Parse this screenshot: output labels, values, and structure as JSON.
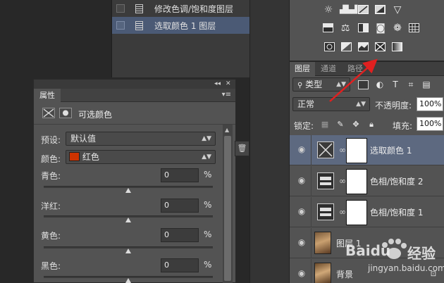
{
  "history": {
    "items": [
      {
        "label": "修改色调/饱和度图层",
        "selected": false
      },
      {
        "label": "选取颜色 1 图层",
        "selected": true
      }
    ]
  },
  "properties": {
    "tab_label": "属性",
    "title": "可选颜色",
    "preset_label": "预设:",
    "preset_value": "默认值",
    "colors_label": "颜色:",
    "colors_value": "红色",
    "colors_swatch": "#cc3300",
    "sliders": [
      {
        "label": "青色:",
        "value": "0",
        "unit": "%",
        "level": 0.5
      },
      {
        "label": "洋红:",
        "value": "0",
        "unit": "%",
        "level": 0.5
      },
      {
        "label": "黄色:",
        "value": "0",
        "unit": "%",
        "level": 0.5
      },
      {
        "label": "黑色:",
        "value": "0",
        "unit": "%",
        "level": 0.5
      }
    ]
  },
  "layers_panel": {
    "tabs": [
      "图层",
      "通道",
      "路径"
    ],
    "active_tab": "图层",
    "filter_kind": "类型",
    "blend_mode": "正常",
    "opacity_label": "不透明度:",
    "opacity_value": "100%",
    "lock_label": "锁定:",
    "fill_label": "填充:",
    "fill_value": "100%",
    "layers": [
      {
        "name": "选取颜色 1",
        "kind": "selective-color-adjustment",
        "selected": true
      },
      {
        "name": "色相/饱和度 2",
        "kind": "hue-saturation-adjustment",
        "selected": false
      },
      {
        "name": "色相/饱和度 1",
        "kind": "hue-saturation-adjustment",
        "selected": false
      },
      {
        "name": "图层 1",
        "kind": "photo",
        "selected": false
      },
      {
        "name": "背景",
        "kind": "photo-locked",
        "selected": false
      }
    ]
  },
  "watermark": {
    "brand": "Baidu",
    "product": "经验",
    "url": "jingyan.baidu.com"
  },
  "colors": {
    "annotation_arrow": "#e02020",
    "selection": "#5d6980"
  }
}
